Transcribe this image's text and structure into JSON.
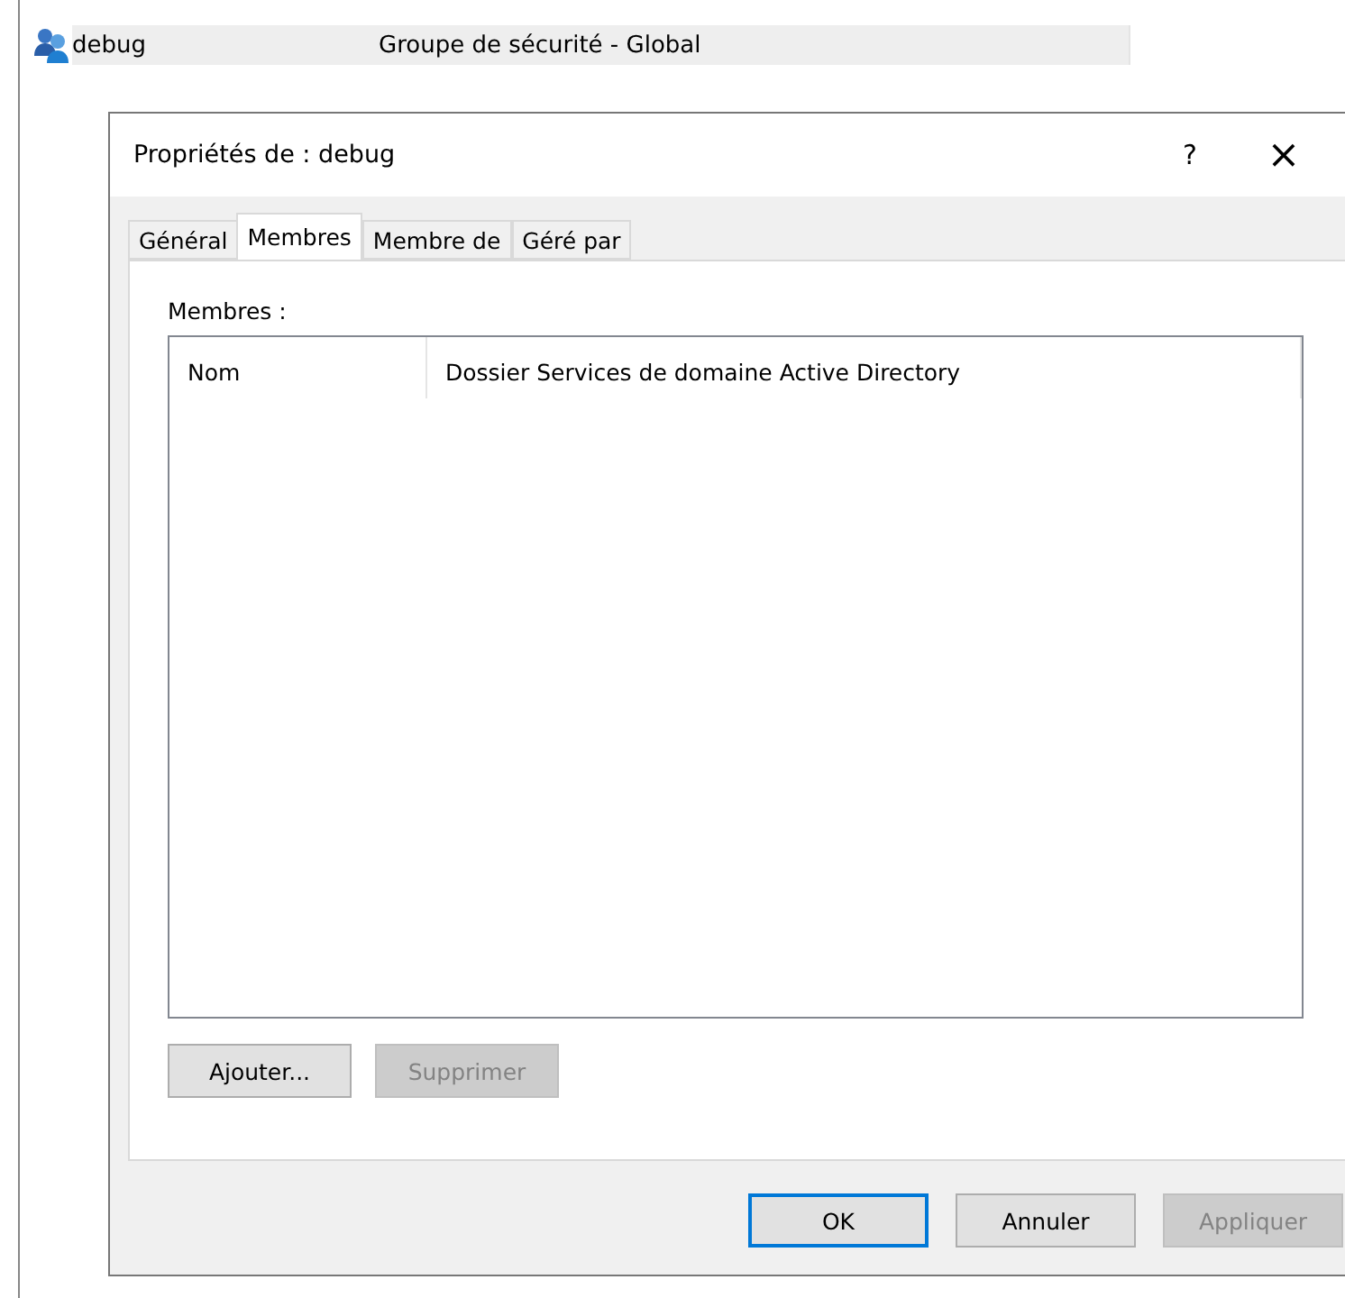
{
  "background_list": {
    "row": {
      "name": "debug",
      "type": "Groupe de sécurité - Global",
      "selected": true
    }
  },
  "dialog": {
    "title": "Propriétés de : debug",
    "help": "?",
    "close": "×",
    "tabs": [
      {
        "label": "Général",
        "selected": false
      },
      {
        "label": "Membres",
        "selected": true
      },
      {
        "label": "Membre de",
        "selected": false
      },
      {
        "label": "Géré par",
        "selected": false
      }
    ],
    "members_label": "Membres :",
    "table": {
      "columns": [
        "Nom",
        "Dossier Services de domaine Active Directory"
      ]
    },
    "list_buttons": [
      {
        "label": "Ajouter...",
        "disabled": false
      },
      {
        "label": "Supprimer",
        "disabled": true
      }
    ],
    "footer_buttons": [
      {
        "label": "OK",
        "disabled": false,
        "default": true
      },
      {
        "label": "Annuler",
        "disabled": false,
        "default": false
      },
      {
        "label": "Appliquer",
        "disabled": true,
        "default": false
      }
    ]
  }
}
